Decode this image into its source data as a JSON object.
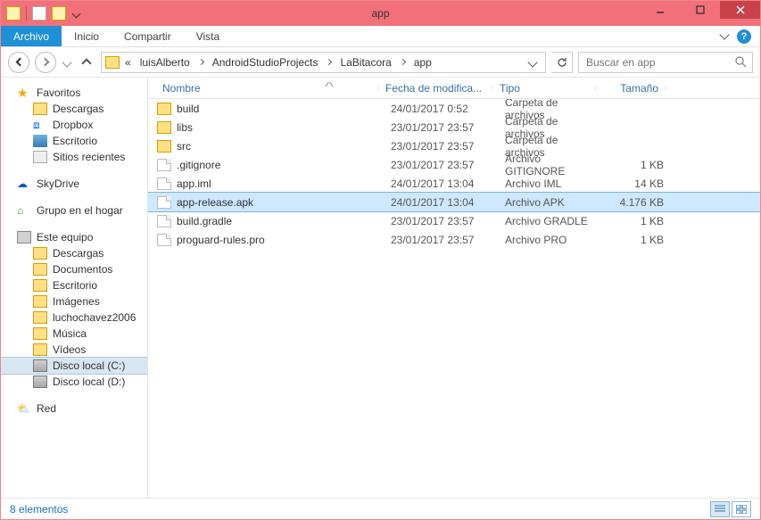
{
  "window": {
    "title": "app"
  },
  "ribbon": {
    "file": "Archivo",
    "tabs": [
      "Inicio",
      "Compartir",
      "Vista"
    ]
  },
  "breadcrumb": {
    "prefix": "«",
    "items": [
      "luisAlberto",
      "AndroidStudioProjects",
      "LaBitacora",
      "app"
    ]
  },
  "search": {
    "placeholder": "Buscar en app"
  },
  "nav": {
    "favorites": {
      "label": "Favoritos",
      "items": [
        {
          "label": "Descargas",
          "icon": "folder"
        },
        {
          "label": "Dropbox",
          "icon": "dropbox"
        },
        {
          "label": "Escritorio",
          "icon": "desktop"
        },
        {
          "label": "Sitios recientes",
          "icon": "recent"
        }
      ]
    },
    "skydrive": {
      "label": "SkyDrive"
    },
    "homegroup": {
      "label": "Grupo en el hogar"
    },
    "pc": {
      "label": "Este equipo",
      "items": [
        {
          "label": "Descargas",
          "icon": "folder"
        },
        {
          "label": "Documentos",
          "icon": "folder"
        },
        {
          "label": "Escritorio",
          "icon": "folder"
        },
        {
          "label": "Imágenes",
          "icon": "folder"
        },
        {
          "label": "luchochavez2006",
          "icon": "folder"
        },
        {
          "label": "Música",
          "icon": "folder"
        },
        {
          "label": "Vídeos",
          "icon": "folder"
        },
        {
          "label": "Disco local (C:)",
          "icon": "disk",
          "selected": true
        },
        {
          "label": "Disco local (D:)",
          "icon": "disk"
        }
      ]
    },
    "network": {
      "label": "Red"
    }
  },
  "columns": {
    "name": "Nombre",
    "date": "Fecha de modifica...",
    "type": "Tipo",
    "size": "Tamaño"
  },
  "files": [
    {
      "name": "build",
      "date": "24/01/2017 0:52",
      "type": "Carpeta de archivos",
      "size": "",
      "icon": "folder"
    },
    {
      "name": "libs",
      "date": "23/01/2017 23:57",
      "type": "Carpeta de archivos",
      "size": "",
      "icon": "folder"
    },
    {
      "name": "src",
      "date": "23/01/2017 23:57",
      "type": "Carpeta de archivos",
      "size": "",
      "icon": "folder"
    },
    {
      "name": ".gitignore",
      "date": "23/01/2017 23:57",
      "type": "Archivo GITIGNORE",
      "size": "1 KB",
      "icon": "file"
    },
    {
      "name": "app.iml",
      "date": "24/01/2017 13:04",
      "type": "Archivo IML",
      "size": "14 KB",
      "icon": "file"
    },
    {
      "name": "app-release.apk",
      "date": "24/01/2017 13:04",
      "type": "Archivo APK",
      "size": "4.176 KB",
      "icon": "file",
      "selected": true
    },
    {
      "name": "build.gradle",
      "date": "23/01/2017 23:57",
      "type": "Archivo GRADLE",
      "size": "1 KB",
      "icon": "file"
    },
    {
      "name": "proguard-rules.pro",
      "date": "23/01/2017 23:57",
      "type": "Archivo PRO",
      "size": "1 KB",
      "icon": "file"
    }
  ],
  "status": {
    "text": "8 elementos"
  }
}
